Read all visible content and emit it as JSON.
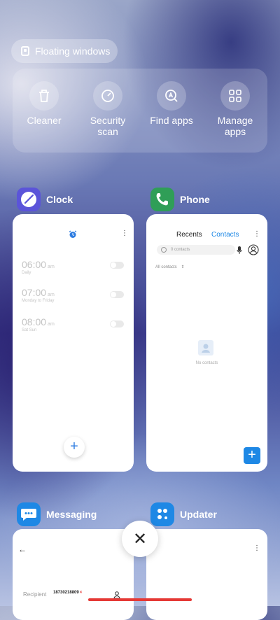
{
  "floating_windows": {
    "label": "Floating windows"
  },
  "tools": [
    {
      "label": "Cleaner",
      "icon": "trash-icon"
    },
    {
      "label": "Security\nscan",
      "icon": "gauge-icon"
    },
    {
      "label": "Find apps",
      "icon": "search-apps-icon"
    },
    {
      "label": "Manage\napps",
      "icon": "grid-icon"
    }
  ],
  "apps": {
    "clock": {
      "title": "Clock",
      "alarms": [
        {
          "time": "06:00",
          "ampm": "am",
          "repeat": "Daily"
        },
        {
          "time": "07:00",
          "ampm": "am",
          "repeat": "Monday to Friday"
        },
        {
          "time": "08:00",
          "ampm": "am",
          "repeat": "Sat Sun"
        }
      ],
      "fab": "+"
    },
    "phone": {
      "title": "Phone",
      "tabs": [
        "Recents",
        "Contacts"
      ],
      "active_tab": "Contacts",
      "search_placeholder": "0 contacts",
      "filter": "All contacts",
      "empty_text": "No contacts",
      "fab": "+"
    },
    "messaging": {
      "title": "Messaging",
      "recipient_label": "Recipient",
      "recipient_value": "18730218809"
    },
    "updater": {
      "title": "Updater"
    }
  },
  "colors": {
    "clock_icon": "#5b54d9",
    "phone_icon": "#2f9e57",
    "messaging_icon": "#1e88e5",
    "updater_icon": "#1e88e5",
    "accent": "#1e88e5",
    "home_bar": "#e53935"
  },
  "close_button": {
    "symbol": "✕"
  }
}
